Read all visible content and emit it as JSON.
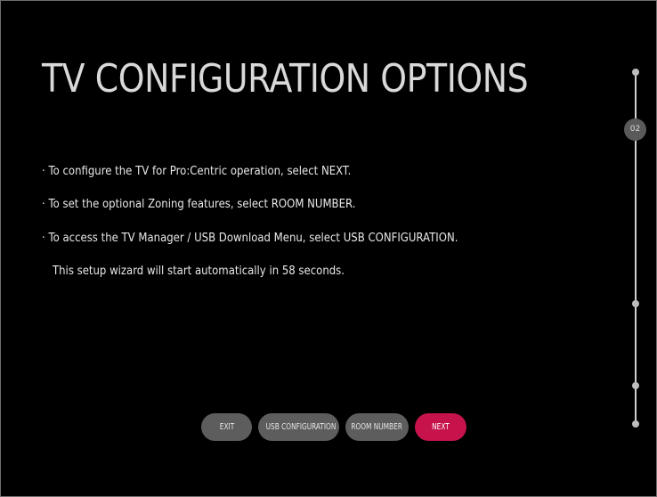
{
  "header": {
    "title": "TV CONFIGURATION OPTIONS"
  },
  "instructions": {
    "line1": "· To configure the TV for Pro:Centric operation, select NEXT.",
    "line2": "· To set the optional Zoning features, select ROOM NUMBER.",
    "line3": "· To access the TV Manager / USB Download Menu, select USB CONFIGURATION.",
    "countdown": "This setup wizard will start automatically in 58 seconds."
  },
  "stepper": {
    "current_step": "02"
  },
  "buttons": {
    "exit": "EXIT",
    "usb_configuration": "USB CONFIGURATION",
    "room_number": "ROOM NUMBER",
    "next": "NEXT"
  },
  "colors": {
    "background": "#000000",
    "accent": "#c6134b",
    "button": "#5d5d5d"
  }
}
